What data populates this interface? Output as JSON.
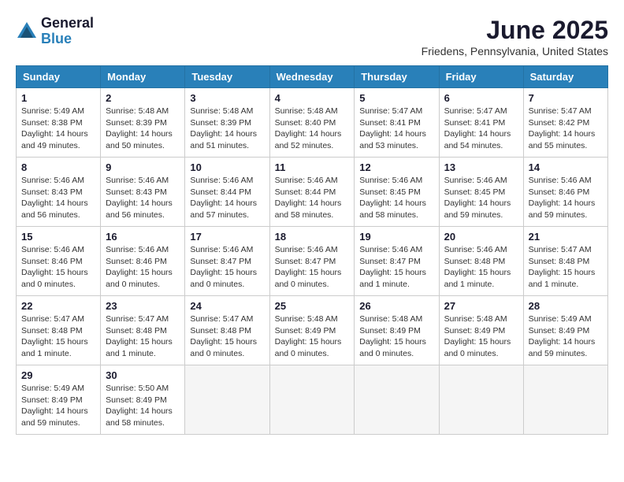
{
  "header": {
    "logo_general": "General",
    "logo_blue": "Blue",
    "month_title": "June 2025",
    "location": "Friedens, Pennsylvania, United States"
  },
  "days_of_week": [
    "Sunday",
    "Monday",
    "Tuesday",
    "Wednesday",
    "Thursday",
    "Friday",
    "Saturday"
  ],
  "weeks": [
    [
      {
        "day": "1",
        "info": "Sunrise: 5:49 AM\nSunset: 8:38 PM\nDaylight: 14 hours\nand 49 minutes."
      },
      {
        "day": "2",
        "info": "Sunrise: 5:48 AM\nSunset: 8:39 PM\nDaylight: 14 hours\nand 50 minutes."
      },
      {
        "day": "3",
        "info": "Sunrise: 5:48 AM\nSunset: 8:39 PM\nDaylight: 14 hours\nand 51 minutes."
      },
      {
        "day": "4",
        "info": "Sunrise: 5:48 AM\nSunset: 8:40 PM\nDaylight: 14 hours\nand 52 minutes."
      },
      {
        "day": "5",
        "info": "Sunrise: 5:47 AM\nSunset: 8:41 PM\nDaylight: 14 hours\nand 53 minutes."
      },
      {
        "day": "6",
        "info": "Sunrise: 5:47 AM\nSunset: 8:41 PM\nDaylight: 14 hours\nand 54 minutes."
      },
      {
        "day": "7",
        "info": "Sunrise: 5:47 AM\nSunset: 8:42 PM\nDaylight: 14 hours\nand 55 minutes."
      }
    ],
    [
      {
        "day": "8",
        "info": "Sunrise: 5:46 AM\nSunset: 8:43 PM\nDaylight: 14 hours\nand 56 minutes."
      },
      {
        "day": "9",
        "info": "Sunrise: 5:46 AM\nSunset: 8:43 PM\nDaylight: 14 hours\nand 56 minutes."
      },
      {
        "day": "10",
        "info": "Sunrise: 5:46 AM\nSunset: 8:44 PM\nDaylight: 14 hours\nand 57 minutes."
      },
      {
        "day": "11",
        "info": "Sunrise: 5:46 AM\nSunset: 8:44 PM\nDaylight: 14 hours\nand 58 minutes."
      },
      {
        "day": "12",
        "info": "Sunrise: 5:46 AM\nSunset: 8:45 PM\nDaylight: 14 hours\nand 58 minutes."
      },
      {
        "day": "13",
        "info": "Sunrise: 5:46 AM\nSunset: 8:45 PM\nDaylight: 14 hours\nand 59 minutes."
      },
      {
        "day": "14",
        "info": "Sunrise: 5:46 AM\nSunset: 8:46 PM\nDaylight: 14 hours\nand 59 minutes."
      }
    ],
    [
      {
        "day": "15",
        "info": "Sunrise: 5:46 AM\nSunset: 8:46 PM\nDaylight: 15 hours\nand 0 minutes."
      },
      {
        "day": "16",
        "info": "Sunrise: 5:46 AM\nSunset: 8:46 PM\nDaylight: 15 hours\nand 0 minutes."
      },
      {
        "day": "17",
        "info": "Sunrise: 5:46 AM\nSunset: 8:47 PM\nDaylight: 15 hours\nand 0 minutes."
      },
      {
        "day": "18",
        "info": "Sunrise: 5:46 AM\nSunset: 8:47 PM\nDaylight: 15 hours\nand 0 minutes."
      },
      {
        "day": "19",
        "info": "Sunrise: 5:46 AM\nSunset: 8:47 PM\nDaylight: 15 hours\nand 1 minute."
      },
      {
        "day": "20",
        "info": "Sunrise: 5:46 AM\nSunset: 8:48 PM\nDaylight: 15 hours\nand 1 minute."
      },
      {
        "day": "21",
        "info": "Sunrise: 5:47 AM\nSunset: 8:48 PM\nDaylight: 15 hours\nand 1 minute."
      }
    ],
    [
      {
        "day": "22",
        "info": "Sunrise: 5:47 AM\nSunset: 8:48 PM\nDaylight: 15 hours\nand 1 minute."
      },
      {
        "day": "23",
        "info": "Sunrise: 5:47 AM\nSunset: 8:48 PM\nDaylight: 15 hours\nand 1 minute."
      },
      {
        "day": "24",
        "info": "Sunrise: 5:47 AM\nSunset: 8:48 PM\nDaylight: 15 hours\nand 0 minutes."
      },
      {
        "day": "25",
        "info": "Sunrise: 5:48 AM\nSunset: 8:49 PM\nDaylight: 15 hours\nand 0 minutes."
      },
      {
        "day": "26",
        "info": "Sunrise: 5:48 AM\nSunset: 8:49 PM\nDaylight: 15 hours\nand 0 minutes."
      },
      {
        "day": "27",
        "info": "Sunrise: 5:48 AM\nSunset: 8:49 PM\nDaylight: 15 hours\nand 0 minutes."
      },
      {
        "day": "28",
        "info": "Sunrise: 5:49 AM\nSunset: 8:49 PM\nDaylight: 14 hours\nand 59 minutes."
      }
    ],
    [
      {
        "day": "29",
        "info": "Sunrise: 5:49 AM\nSunset: 8:49 PM\nDaylight: 14 hours\nand 59 minutes."
      },
      {
        "day": "30",
        "info": "Sunrise: 5:50 AM\nSunset: 8:49 PM\nDaylight: 14 hours\nand 58 minutes."
      },
      {
        "day": "",
        "info": ""
      },
      {
        "day": "",
        "info": ""
      },
      {
        "day": "",
        "info": ""
      },
      {
        "day": "",
        "info": ""
      },
      {
        "day": "",
        "info": ""
      }
    ]
  ]
}
